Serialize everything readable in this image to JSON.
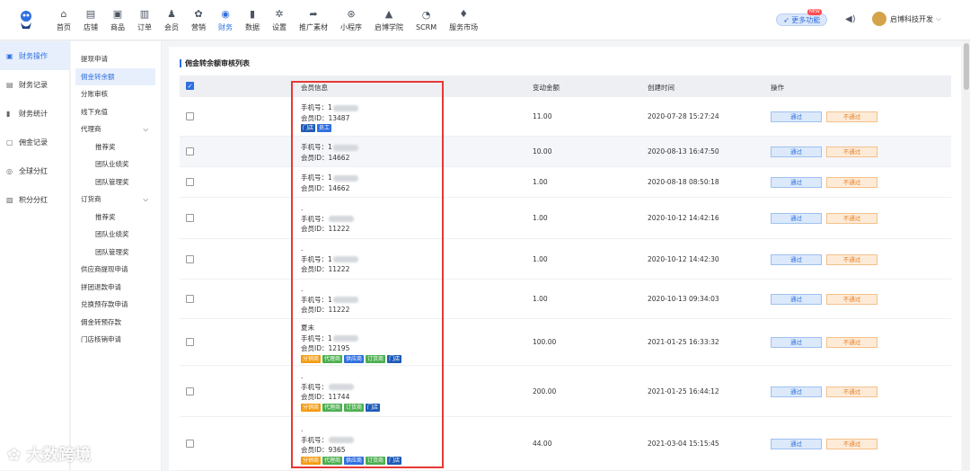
{
  "nav": [
    {
      "label": "首页",
      "icon": "home-icon",
      "glyph": "⌂"
    },
    {
      "label": "店铺",
      "icon": "store-icon",
      "glyph": "▤"
    },
    {
      "label": "商品",
      "icon": "goods-icon",
      "glyph": "▣"
    },
    {
      "label": "订单",
      "icon": "order-icon",
      "glyph": "▥"
    },
    {
      "label": "会员",
      "icon": "member-icon",
      "glyph": "♟"
    },
    {
      "label": "营销",
      "icon": "marketing-icon",
      "glyph": "✿"
    },
    {
      "label": "财务",
      "icon": "finance-icon",
      "glyph": "◉",
      "active": true
    },
    {
      "label": "数据",
      "icon": "data-icon",
      "glyph": "▮"
    },
    {
      "label": "设置",
      "icon": "settings-icon",
      "glyph": "✲"
    },
    {
      "label": "推广素材",
      "icon": "share-icon",
      "glyph": "➦"
    },
    {
      "label": "小程序",
      "icon": "miniprogram-icon",
      "glyph": "⊛"
    },
    {
      "label": "启博学院",
      "icon": "academy-icon",
      "glyph": "▲"
    },
    {
      "label": "SCRM",
      "icon": "scrm-icon",
      "glyph": "◔"
    },
    {
      "label": "服务市场",
      "icon": "market-icon",
      "glyph": "♦"
    }
  ],
  "header": {
    "more_label": "更多功能",
    "new_badge": "NEW",
    "user_name": "启博科技开发"
  },
  "sidebar": [
    {
      "label": "财务操作",
      "icon": "operate-icon",
      "glyph": "▣",
      "active": true
    },
    {
      "label": "财务记录",
      "icon": "record-icon",
      "glyph": "▤"
    },
    {
      "label": "财务统计",
      "icon": "stats-icon",
      "glyph": "▮"
    },
    {
      "label": "佣金记录",
      "icon": "commission-icon",
      "glyph": "▢"
    },
    {
      "label": "全球分红",
      "icon": "global-icon",
      "glyph": "◎"
    },
    {
      "label": "积分分红",
      "icon": "points-icon",
      "glyph": "▧"
    }
  ],
  "subnav": [
    {
      "label": "提现申请",
      "level": 1
    },
    {
      "label": "佣金转余额",
      "level": 1,
      "active": true
    },
    {
      "label": "分账审核",
      "level": 1
    },
    {
      "label": "线下充值",
      "level": 1
    },
    {
      "label": "代理商",
      "level": 1,
      "caret": true
    },
    {
      "label": "推荐奖",
      "level": 2
    },
    {
      "label": "团队业绩奖",
      "level": 2
    },
    {
      "label": "团队管理奖",
      "level": 2
    },
    {
      "label": "订货商",
      "level": 1,
      "caret": true
    },
    {
      "label": "推荐奖",
      "level": 2
    },
    {
      "label": "团队业绩奖",
      "level": 2
    },
    {
      "label": "团队管理奖",
      "level": 2
    },
    {
      "label": "供应商提现申请",
      "level": 1
    },
    {
      "label": "拼团退款申请",
      "level": 1
    },
    {
      "label": "兑换预存款申请",
      "level": 1
    },
    {
      "label": "佣金转预存款",
      "level": 1
    },
    {
      "label": "门店核销申请",
      "level": 1
    }
  ],
  "page": {
    "title": "佣金转余额审核列表"
  },
  "table": {
    "headers": {
      "member": "会员信息",
      "amount": "变动金额",
      "created": "创建时间",
      "action": "操作"
    },
    "pass_label": "通过",
    "fail_label": "不通过",
    "rows": [
      {
        "lines": [
          "手机号：1",
          "会员ID：13487"
        ],
        "tags": [
          [
            "门店",
            "t-deep"
          ],
          [
            "员工",
            "t-blue"
          ]
        ],
        "amount": "11.00",
        "time": "2020-07-28 15:27:24"
      },
      {
        "lines": [
          "手机号：1",
          "会员ID：14662"
        ],
        "tags": [],
        "amount": "10.00",
        "time": "2020-08-13 16:47:50"
      },
      {
        "lines": [
          "手机号：1",
          "会员ID：14662"
        ],
        "tags": [],
        "amount": "1.00",
        "time": "2020-08-18 08:50:18"
      },
      {
        "lines": [
          ".",
          "手机号：",
          "会员ID：11222"
        ],
        "tags": [],
        "amount": "1.00",
        "time": "2020-10-12 14:42:16"
      },
      {
        "lines": [
          ".",
          "手机号：1",
          "会员ID：11222"
        ],
        "tags": [],
        "amount": "1.00",
        "time": "2020-10-12 14:42:30"
      },
      {
        "lines": [
          ".",
          "手机号：1",
          "会员ID：11222"
        ],
        "tags": [],
        "amount": "1.00",
        "time": "2020-10-13 09:34:03"
      },
      {
        "lines": [
          "夏末",
          "手机号：1",
          "会员ID：12195"
        ],
        "tags": [
          [
            "分销商",
            "t-orange"
          ],
          [
            "代理商",
            "t-green"
          ],
          [
            "供应商",
            "t-blue"
          ],
          [
            "订货商",
            "t-green"
          ],
          [
            "门店",
            "t-deep"
          ]
        ],
        "amount": "100.00",
        "time": "2021-01-25 16:33:32"
      },
      {
        "lines": [
          ".",
          "手机号：",
          "会员ID：11744"
        ],
        "tags": [
          [
            "分销商",
            "t-orange"
          ],
          [
            "代理商",
            "t-green"
          ],
          [
            "订货商",
            "t-green"
          ],
          [
            "门店",
            "t-deep"
          ]
        ],
        "amount": "200.00",
        "time": "2021-01-25 16:44:12"
      },
      {
        "lines": [
          ".",
          "手机号：",
          "会员ID：9365"
        ],
        "tags": [
          [
            "分销商",
            "t-orange"
          ],
          [
            "代理商",
            "t-green"
          ],
          [
            "供应商",
            "t-blue"
          ],
          [
            "订货商",
            "t-green"
          ],
          [
            "门店",
            "t-deep"
          ]
        ],
        "amount": "44.00",
        "time": "2021-03-04 15:15:45"
      }
    ]
  },
  "watermark": "大数跨境"
}
